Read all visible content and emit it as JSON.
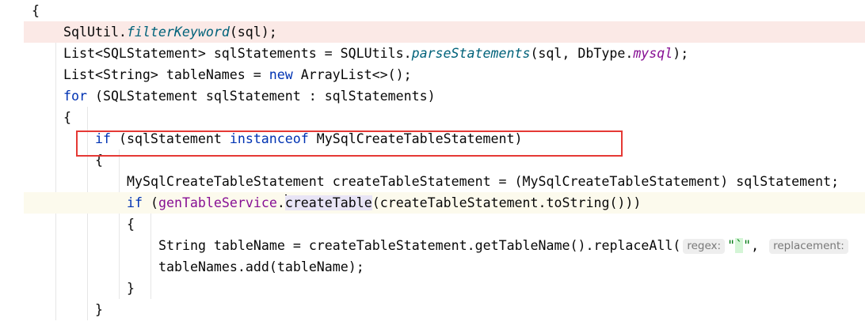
{
  "editor": {
    "highlight_color": "#e53935",
    "lines": [
      {
        "indent": 1,
        "tokens": [
          {
            "t": "{"
          }
        ]
      },
      {
        "indent": 2,
        "style": "err",
        "tokens": [
          {
            "t": "SqlUtil."
          },
          {
            "t": "filterKeyword",
            "c": "mth"
          },
          {
            "t": "(sql);"
          }
        ]
      },
      {
        "indent": 2,
        "tokens": [
          {
            "t": "List<SQLStatement> sqlStatements = SQLUtils."
          },
          {
            "t": "parseStatements",
            "c": "mth"
          },
          {
            "t": "(sql, DbType."
          },
          {
            "t": "mysql",
            "c": "fld"
          },
          {
            "t": ");"
          }
        ]
      },
      {
        "indent": 2,
        "tokens": [
          {
            "t": "List<String> tableNames = "
          },
          {
            "t": "new",
            "c": "kw"
          },
          {
            "t": " ArrayList<>();"
          }
        ]
      },
      {
        "indent": 2,
        "tokens": [
          {
            "t": "for",
            "c": "kw"
          },
          {
            "t": " (SQLStatement sqlStatement : sqlStatements)"
          }
        ]
      },
      {
        "indent": 2,
        "tokens": [
          {
            "t": "{"
          }
        ]
      },
      {
        "indent": 3,
        "tokens": [
          {
            "t": "if",
            "c": "kw"
          },
          {
            "t": " (sqlStatement "
          },
          {
            "t": "instanceof",
            "c": "kw"
          },
          {
            "t": " MySqlCreateTableStatement)"
          }
        ]
      },
      {
        "indent": 3,
        "tokens": [
          {
            "t": "{"
          }
        ]
      },
      {
        "indent": 4,
        "tokens": [
          {
            "t": "MySqlCreateTableStatement createTableStatement = (MySqlCreateTableStatement) sqlStatement;"
          }
        ]
      },
      {
        "indent": 4,
        "style": "cur",
        "tokens": [
          {
            "t": "if",
            "c": "kw"
          },
          {
            "t": " ("
          },
          {
            "t": "genTableService",
            "c": "fld2"
          },
          {
            "t": "."
          },
          {
            "t": "",
            "c": "caret"
          },
          {
            "t": "createTable",
            "c": "word"
          },
          {
            "t": "(createTableStatement.toString()))"
          }
        ]
      },
      {
        "indent": 4,
        "tokens": [
          {
            "t": "{"
          }
        ]
      },
      {
        "indent": 5,
        "tokens": [
          {
            "t": "String tableName = createTableStatement.getTableName().replaceAll("
          },
          {
            "t": "regex:",
            "c": "hint"
          },
          {
            "t": "\"",
            "c": "str"
          },
          {
            "t": "`",
            "c": "tick"
          },
          {
            "t": "\"",
            "c": "str"
          },
          {
            "t": ", "
          },
          {
            "t": "replacement:",
            "c": "hint"
          }
        ]
      },
      {
        "indent": 5,
        "tokens": [
          {
            "t": "tableNames.add(tableName);"
          }
        ]
      },
      {
        "indent": 4,
        "tokens": [
          {
            "t": "}"
          }
        ]
      },
      {
        "indent": 3,
        "tokens": [
          {
            "t": "}"
          }
        ]
      }
    ]
  }
}
